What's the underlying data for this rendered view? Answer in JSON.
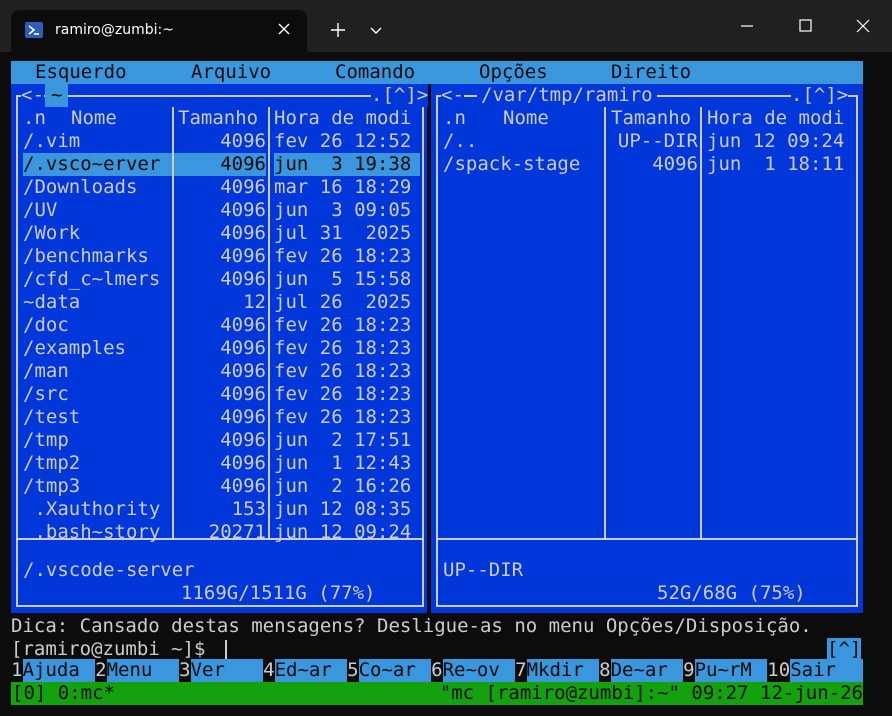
{
  "window": {
    "tab_title": "ramiro@zumbi:~",
    "new_tab_icon": "plus-icon",
    "dropdown_icon": "chevron-down-icon"
  },
  "menubar": [
    "Esquerdo",
    "Arquivo",
    "Comando",
    "Opções",
    "Direito"
  ],
  "left_panel": {
    "top_left": "<-",
    "tab_label": "~",
    "top_right": ".[^]>",
    "headers": {
      "name_prefix": ".n",
      "name": "Nome",
      "size": "Tamanho",
      "time": "Hora de modi"
    },
    "rows": [
      {
        "name": "/.vim",
        "size": "4096",
        "time": "fev 26 12:52"
      },
      {
        "name": "/.vsco~erver",
        "size": "4096",
        "time": "jun  3 19:38",
        "selected": true
      },
      {
        "name": "/Downloads",
        "size": "4096",
        "time": "mar 16 18:29"
      },
      {
        "name": "/UV",
        "size": "4096",
        "time": "jun  3 09:05"
      },
      {
        "name": "/Work",
        "size": "4096",
        "time": "jul 31  2025"
      },
      {
        "name": "/benchmarks",
        "size": "4096",
        "time": "fev 26 18:23"
      },
      {
        "name": "/cfd_c~lmers",
        "size": "4096",
        "time": "jun  5 15:58"
      },
      {
        "name": "~data",
        "size": "12",
        "time": "jul 26  2025"
      },
      {
        "name": "/doc",
        "size": "4096",
        "time": "fev 26 18:23"
      },
      {
        "name": "/examples",
        "size": "4096",
        "time": "fev 26 18:23"
      },
      {
        "name": "/man",
        "size": "4096",
        "time": "fev 26 18:23"
      },
      {
        "name": "/src",
        "size": "4096",
        "time": "fev 26 18:23"
      },
      {
        "name": "/test",
        "size": "4096",
        "time": "fev 26 18:23"
      },
      {
        "name": "/tmp",
        "size": "4096",
        "time": "jun  2 17:51"
      },
      {
        "name": "/tmp2",
        "size": "4096",
        "time": "jun  1 12:43"
      },
      {
        "name": "/tmp3",
        "size": "4096",
        "time": "jun  2 16:26"
      },
      {
        "name": " .Xauthority",
        "size": "153",
        "time": "jun 12 08:35"
      },
      {
        "name": " .bash~story",
        "size": "20271",
        "time": "jun 12 09:24"
      }
    ],
    "status": "/.vscode-server",
    "disk": "1169G/1511G (77%)"
  },
  "right_panel": {
    "top_left": "<-",
    "path": "/var/tmp/ramiro",
    "top_right": ".[^]>",
    "headers": {
      "name_prefix": ".n",
      "name": "Nome",
      "size": "Tamanho",
      "time": "Hora de modi"
    },
    "rows": [
      {
        "name": "/..",
        "size": "UP--DIR",
        "time": "jun 12 09:24"
      },
      {
        "name": "/spack-stage",
        "size": "4096",
        "time": "jun  1 18:11"
      }
    ],
    "status": "UP--DIR",
    "disk": "52G/68G (75%)"
  },
  "hint": "Dica: Cansado destas mensagens? Desligue-as no menu Opções/Disposição.",
  "prompt": "[ramiro@zumbi ~]$ ",
  "history_button": "[^]",
  "fkeys": [
    {
      "num": "1",
      "label": "Ajuda"
    },
    {
      "num": "2",
      "label": "Menu"
    },
    {
      "num": "3",
      "label": "Ver"
    },
    {
      "num": "4",
      "label": "Ed~ar"
    },
    {
      "num": "5",
      "label": "Co~ar"
    },
    {
      "num": "6",
      "label": "Re~ov"
    },
    {
      "num": "7",
      "label": "Mkdir"
    },
    {
      "num": "8",
      "label": "De~ar"
    },
    {
      "num": "9",
      "label": "Pu~rM"
    },
    {
      "num": "10",
      "label": "Sair"
    }
  ],
  "tmux": {
    "left": "[0] 0:mc*",
    "right": "\"mc [ramiro@zumbi]:~\" 09:27 12-jun-26"
  },
  "colors": {
    "panel_bg": "#0037da",
    "highlight": "#3a96dd",
    "header_yellow": "#c19c00",
    "status_green": "#13a10e"
  }
}
